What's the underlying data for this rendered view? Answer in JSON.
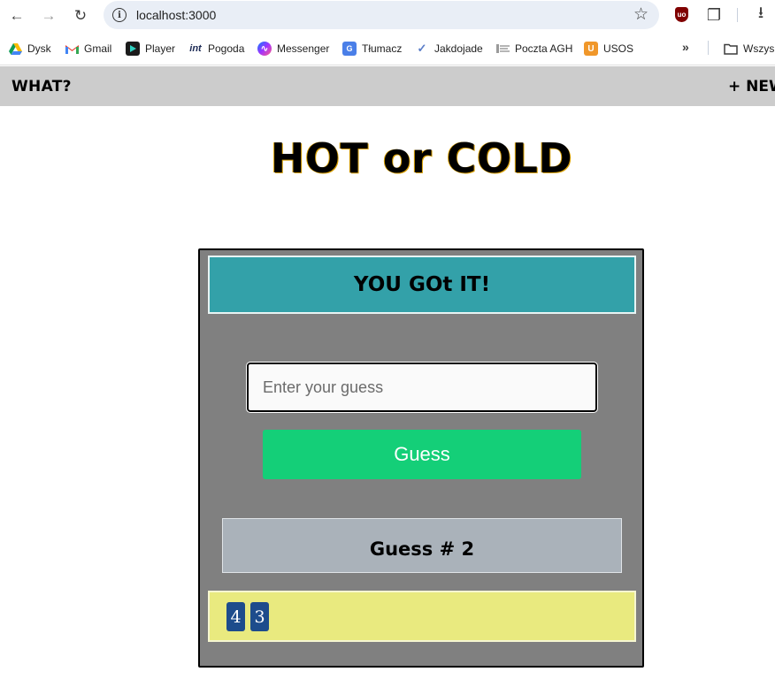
{
  "browser": {
    "url": "localhost:3000",
    "bookmarks": [
      {
        "label": "Dysk",
        "icon": "google-drive-icon"
      },
      {
        "label": "Gmail",
        "icon": "gmail-icon"
      },
      {
        "label": "Player",
        "icon": "player-icon"
      },
      {
        "label": "Pogoda",
        "icon": "weather-icon",
        "icon_text": "int"
      },
      {
        "label": "Messenger",
        "icon": "messenger-icon"
      },
      {
        "label": "Tłumacz",
        "icon": "translate-icon"
      },
      {
        "label": "Jakdojade",
        "icon": "jakdojade-icon"
      },
      {
        "label": "Poczta AGH",
        "icon": "mail-icon"
      },
      {
        "label": "USOS",
        "icon": "usos-icon",
        "icon_text": "U"
      }
    ],
    "overflow_label": "»",
    "folder_label": "Wszys"
  },
  "appbar": {
    "left": "WHAT?",
    "right": "+ NEW"
  },
  "title": "HOT or COLD",
  "game": {
    "feedback": "YOU GOt IT!",
    "input_placeholder": "Enter your guess",
    "input_value": "",
    "button_label": "Guess",
    "count_text": "Guess # 2",
    "history": [
      "4",
      "3"
    ]
  },
  "colors": {
    "feedback_bg": "#33a1a9",
    "game_bg": "#808080",
    "button_bg": "#14cf78",
    "history_bg": "#e9ea7f",
    "chip_bg": "#1d4c8c"
  }
}
